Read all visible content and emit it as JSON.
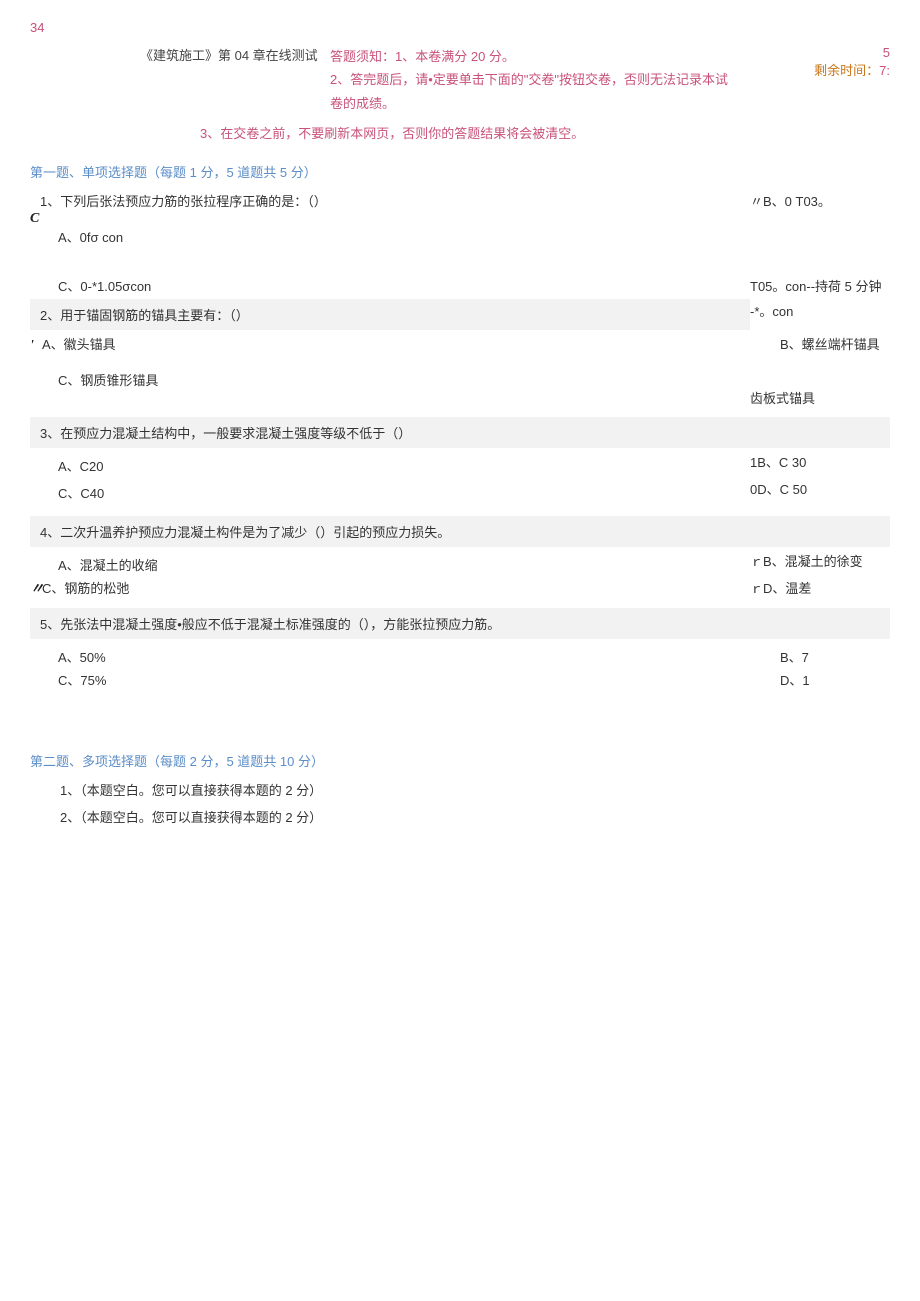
{
  "top_number": "34",
  "header": {
    "title": "《建筑施工》第 04 章在线测试",
    "notice1": "答题须知：1、本卷满分 20 分。",
    "notice2": "2、答完题后，请•定要单击下面的\"交卷\"按钮交卷，否则无法记录本试卷的成绩。",
    "notice3": "3、在交卷之前，不要刷新本网页，否则你的答题结果将会被清空。",
    "time_num": "5",
    "time_label": "剩余时间：",
    "time_val": "7:"
  },
  "section1": {
    "title": "第一题、单项选择题（每题 1 分，5 道题共 5 分）",
    "q1": {
      "stem": "1、下列后张法预应力筋的张拉程序正确的是：（）",
      "marker": "C",
      "a": "A、0fσ con",
      "b": "〃B、0 T03。",
      "c": "C、0-*1.05σcon",
      "c_right": "T05。con--持荷 5 分钟"
    },
    "q2": {
      "stem": "2、用于锚固钢筋的锚具主要有：（）",
      "stem_right": "-*。con",
      "a_marker": "'",
      "a": "A、徽头锚具",
      "b": "B、螺丝端杆锚具",
      "c": "C、钢质锥形锚具",
      "d": "齿板式锚具"
    },
    "q3": {
      "stem": "3、在预应力混凝土结构中，一般要求混凝土强度等级不低于（）",
      "a": "A、C20",
      "b": "1B、C 30",
      "c": "C、C40",
      "d": "0D、C 50"
    },
    "q4": {
      "stem": "4、二次升温养护预应力混凝土构件是为了减少（）引起的预应力损失。",
      "a": "A、混凝土的收缩",
      "b": "ｒB、混凝土的徐变",
      "c_marker": "〃",
      "c": "C、钢筋的松弛",
      "d": "ｒD、温差"
    },
    "q5": {
      "stem": "5、先张法中混凝土强度•般应不低于混凝土标准强度的（），方能张拉预应力筋。",
      "a": "A、50%",
      "b": "B、7",
      "c": "C、75%",
      "d": "D、1"
    }
  },
  "section2": {
    "title": "第二题、多项选择题（每题 2 分，5 道题共 10 分）",
    "q1": "1、（本题空白。您可以直接获得本题的 2 分）",
    "q2": "2、（本题空白。您可以直接获得本题的 2 分）"
  }
}
